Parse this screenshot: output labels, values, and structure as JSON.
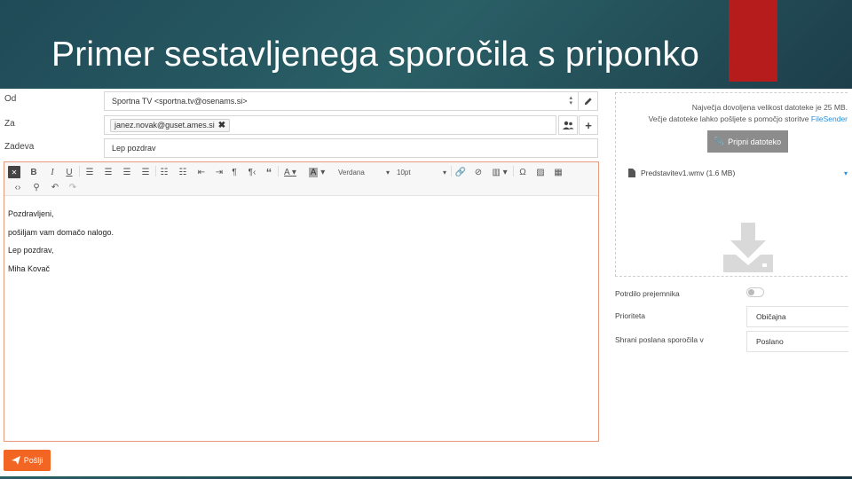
{
  "slide": {
    "title": "Primer sestavljenega sporočila s priponko"
  },
  "colors": {
    "accent_red": "#b71c1c",
    "send_orange": "#f26522",
    "link_blue": "#2b8fd6"
  },
  "compose": {
    "from_label": "Od",
    "from_value": "Sportna TV <sportna.tv@osenams.si>",
    "to_label": "Za",
    "to_chip": "janez.novak@guset.ames.si",
    "subject_label": "Zadeva",
    "subject_value": "Lep pozdrav"
  },
  "toolbar": {
    "font_name": "Verdana",
    "font_size": "10pt"
  },
  "message": {
    "lines": [
      "Pozdravljeni,",
      "pošiljam vam domačo nalogo.",
      "Lep pozdrav,",
      "Miha Kovač"
    ]
  },
  "send_button": {
    "label": "Pošlji"
  },
  "attachments": {
    "info_line1": "Največja dovoljena velikost datoteke je 25 MB.",
    "info_line2_prefix": "Večje datoteke lahko pošljete s pomočjo storitve ",
    "info_link": "FileSender",
    "attach_button": "Pripni datoteko",
    "file_name": "Predstavitev1.wmv (1.6 MB)"
  },
  "options": {
    "receipt_label": "Potrdilo prejemnika",
    "priority_label": "Prioriteta",
    "priority_value": "Običajna",
    "save_label": "Shrani poslana sporočila v",
    "save_value": "Poslano"
  }
}
